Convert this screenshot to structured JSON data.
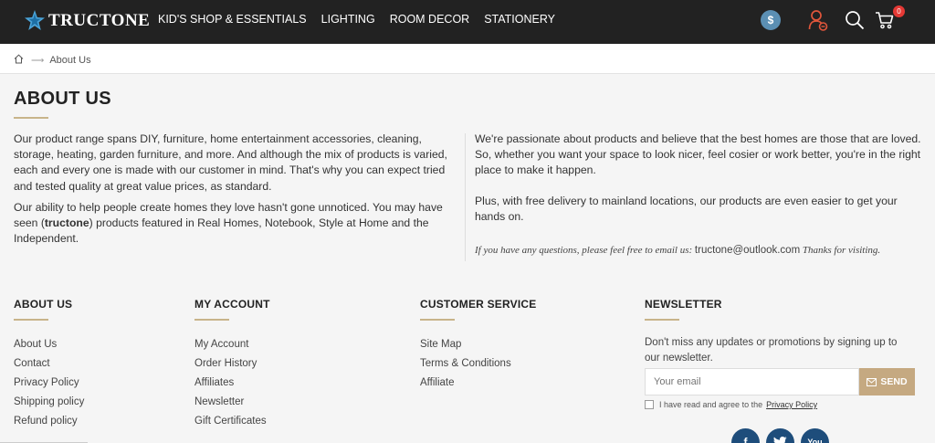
{
  "brand": {
    "name": "TRUCTONE"
  },
  "nav": [
    {
      "label": "KID'S SHOP & ESSENTIALS"
    },
    {
      "label": "LIGHTING"
    },
    {
      "label": "ROOM DECOR"
    },
    {
      "label": "STATIONERY"
    }
  ],
  "header": {
    "currency_symbol": "$",
    "cart_count": "0"
  },
  "breadcrumb": {
    "current": "About Us"
  },
  "page": {
    "title": "ABOUT US",
    "left_p1": "Our product range spans DIY, furniture, home entertainment accessories, cleaning, storage, heating, garden furniture, and more. And although the mix of products is varied, each and every one is made with our customer in mind. That's why you can expect tried and tested quality at great value prices, as standard.",
    "left_p2_a": "Our ability to help people create homes they love hasn't gone unnoticed. You may have seen  (",
    "left_p2_brand": "tructone",
    "left_p2_b": ")  products featured in Real Homes, Notebook, Style at Home and the Independent.",
    "right_p1": "We're passionate about products and believe that the best homes are those that are loved. So, whether you want your space to look nicer, feel cosier or work better, you're in the right place to make it happen.",
    "right_p2": "Plus, with free delivery to mainland locations, our products are even easier to get your hands on.",
    "closing_a": "If you have any questions, please feel free to email us: ",
    "closing_email": "tructone@outlook.com",
    "closing_b": " Thanks for visiting."
  },
  "footer": {
    "about": {
      "heading": "ABOUT US",
      "links": [
        "About Us",
        "Contact",
        "Privacy Policy",
        "Shipping policy",
        "Refund policy"
      ]
    },
    "account": {
      "heading": "MY ACCOUNT",
      "links": [
        "My Account",
        "Order History",
        "Affiliates",
        "Newsletter",
        "Gift Certificates"
      ]
    },
    "service": {
      "heading": "CUSTOMER SERVICE",
      "links": [
        "Site Map",
        "Terms & Conditions",
        "Affiliate"
      ]
    },
    "newsletter": {
      "heading": "NEWSLETTER",
      "text": "Don't miss any updates or promotions by signing up to our newsletter.",
      "placeholder": "Your email",
      "button": "SEND",
      "agree": "I have read and agree to the",
      "policy_link": "Privacy Policy"
    },
    "social_icons": [
      "facebook-icon",
      "twitter-icon",
      "youtube-icon"
    ]
  },
  "colors": {
    "accent": "#c5a981",
    "header_bg": "#222222",
    "social": "#1e4d7b"
  }
}
